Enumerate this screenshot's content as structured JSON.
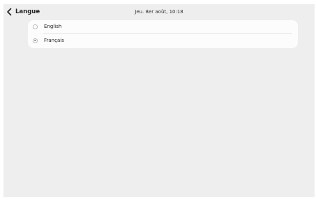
{
  "header": {
    "title": "Langue",
    "back_icon": "chevron-left-icon"
  },
  "status_bar": {
    "datetime": "Jeu. 8er août, 10:18"
  },
  "language_options": [
    {
      "label": "English",
      "selected": false
    },
    {
      "label": "Français",
      "selected": true
    }
  ],
  "colors": {
    "background": "#eeeeee",
    "card": "#fcfcfc",
    "radio_border": "#b9b9b9",
    "radio_selected": "#9a9a9a"
  }
}
